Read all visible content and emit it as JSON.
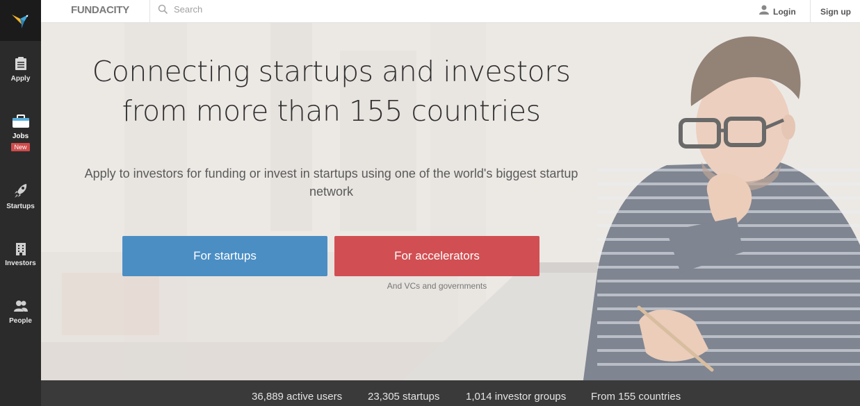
{
  "brand": {
    "name": "FUNDACITY"
  },
  "search": {
    "placeholder": "Search"
  },
  "header": {
    "login_label": "Login",
    "signup_label": "Sign up"
  },
  "sidebar": {
    "items": [
      {
        "label": "Apply",
        "icon": "clipboard-icon"
      },
      {
        "label": "Jobs",
        "icon": "briefcase-icon",
        "badge": "New"
      },
      {
        "label": "Startups",
        "icon": "rocket-icon"
      },
      {
        "label": "Investors",
        "icon": "building-icon"
      },
      {
        "label": "People",
        "icon": "people-icon"
      }
    ]
  },
  "hero": {
    "title_line1": "Connecting startups and investors",
    "title_line2": "from more than 155 countries",
    "subtitle": "Apply to investors for funding or invest in startups using one of the world's biggest startup network",
    "btn_startups": "For startups",
    "btn_accelerators": "For accelerators",
    "accelerators_note": "And VCs and governments"
  },
  "stats": [
    "36,889 active users",
    "23,305 startups",
    "1,014 investor groups",
    "From 155 countries"
  ],
  "colors": {
    "sidebar_bg": "#2b2b2b",
    "btn_startups": "#4b8ec4",
    "btn_accelerators": "#d14f52",
    "badge": "#d14b4b",
    "stats_bg": "#3a3a3a"
  }
}
